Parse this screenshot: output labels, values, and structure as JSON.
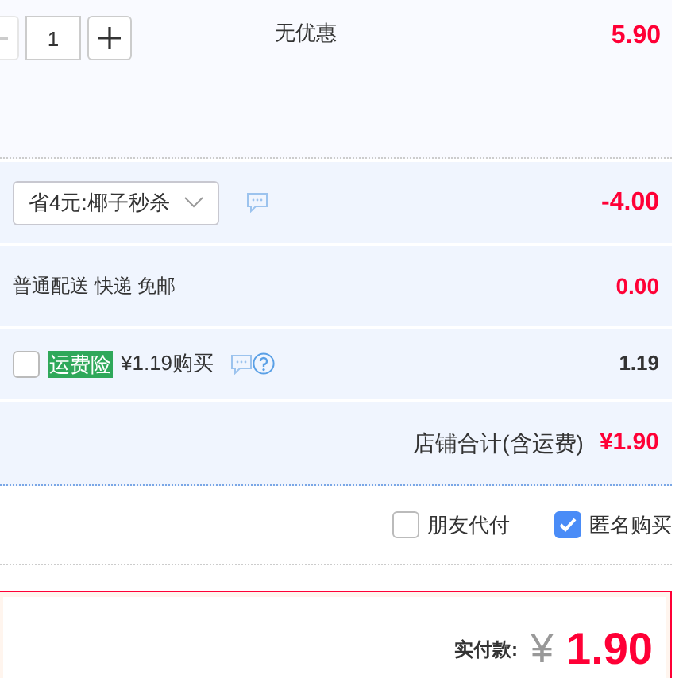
{
  "item": {
    "quantity": "1",
    "minus_disabled": true,
    "discount_note": "无优惠",
    "price": "5.90"
  },
  "promo": {
    "selected_option": "省4元:椰子秒杀",
    "amount": "-4.00"
  },
  "shipping": {
    "label": "普通配送 快递 免邮",
    "amount": "0.00"
  },
  "insurance": {
    "checked": false,
    "tag": "运费险",
    "offer": "¥1.19购买",
    "amount": "1.19"
  },
  "store_total": {
    "label": "店铺合计(含运费)",
    "amount": "¥1.90"
  },
  "options": [
    {
      "label": "朋友代付",
      "checked": false
    },
    {
      "label": "匿名购买",
      "checked": true
    }
  ],
  "payment": {
    "label": "实付款:",
    "currency": "¥",
    "amount": "1.90"
  }
}
